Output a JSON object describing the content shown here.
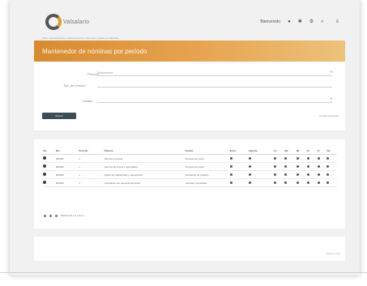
{
  "app": {
    "logo_text": "Valsalario"
  },
  "topbar": {
    "user_label": "Bienvenido",
    "icons": [
      "bell-icon",
      "star-icon",
      "wrench-icon",
      "search-icon",
      "menu-icon"
    ]
  },
  "breadcrumb": "Inicio  /  Administración  /  Mantenimiento  /  Nóminas  /  Listado de Nóminas",
  "page_title": "Mantenedor de nóminas por período",
  "filters": {
    "period_label": "Período",
    "period_value": "Seleccione",
    "nomination_label": "Tipo de nómina",
    "nomination_value": "",
    "status_label": "Estado",
    "status_value": "",
    "search_button": "Buscar",
    "clear_link": "Limpiar búsqueda"
  },
  "table": {
    "headers": [
      "Ver",
      "Nro",
      "Período",
      "Nómina",
      "Estado",
      "Ítems",
      "Importe",
      "Lu",
      "Ma",
      "Mi",
      "Ju",
      "Vi",
      "Sá"
    ],
    "rows": [
      {
        "nro": "000001",
        "periodo": "1",
        "nomina": "Nómina mensual",
        "estado": "Proceso de cierre"
      },
      {
        "nro": "000002",
        "periodo": "1",
        "nomina": "Nómina de bonos y aguinaldos",
        "estado": "Proceso de cierre"
      },
      {
        "nro": "000003",
        "periodo": "1",
        "nomina": "Ajuste por diferencias y retenciones",
        "estado": "Pendiente de revisión"
      },
      {
        "nro": "000004",
        "periodo": "1",
        "nomina": "Liquidación de personal temporal",
        "estado": "Cerrado y aprobado"
      }
    ],
    "footnote": "",
    "pager_label": "Mostrando 1 a 4 de 4"
  },
  "footer": {
    "text": "Versión 1.0.0"
  }
}
